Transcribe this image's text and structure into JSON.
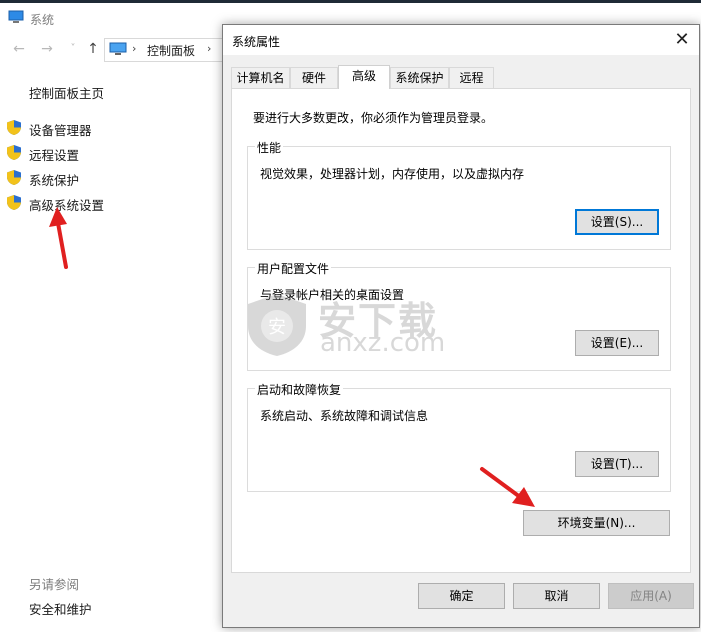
{
  "colors": {
    "accent": "#0078d7",
    "arrow": "#e02020",
    "shield_blue": "#2b6fcf",
    "shield_yellow": "#f2c21b"
  },
  "bg_window": {
    "title": "系统",
    "address_crumb": "控制面板",
    "home_link": "控制面板主页",
    "nav_items": [
      {
        "label": "设备管理器",
        "icon": "shield-icon"
      },
      {
        "label": "远程设置",
        "icon": "shield-icon"
      },
      {
        "label": "系统保护",
        "icon": "shield-icon"
      },
      {
        "label": "高级系统设置",
        "icon": "shield-icon"
      }
    ],
    "see_also": "另请参阅",
    "security_link": "安全和维护"
  },
  "dialog": {
    "title": "系统属性",
    "tabs": [
      {
        "label": "计算机名"
      },
      {
        "label": "硬件"
      },
      {
        "label": "高级",
        "active": true
      },
      {
        "label": "系统保护"
      },
      {
        "label": "远程"
      }
    ],
    "admin_note": "要进行大多数更改，你必须作为管理员登录。",
    "groups": {
      "performance": {
        "title": "性能",
        "desc": "视觉效果，处理器计划，内存使用，以及虚拟内存",
        "button": "设置(S)..."
      },
      "user_profiles": {
        "title": "用户配置文件",
        "desc": "与登录帐户相关的桌面设置",
        "button": "设置(E)..."
      },
      "startup_recovery": {
        "title": "启动和故障恢复",
        "desc": "系统启动、系统故障和调试信息",
        "button": "设置(T)..."
      }
    },
    "env_button": "环境变量(N)...",
    "ok_button": "确定",
    "cancel_button": "取消",
    "apply_button": "应用(A)"
  },
  "watermark": {
    "text_main": "安下载",
    "text_url": "anxz.com",
    "shield_glyph": "安"
  }
}
